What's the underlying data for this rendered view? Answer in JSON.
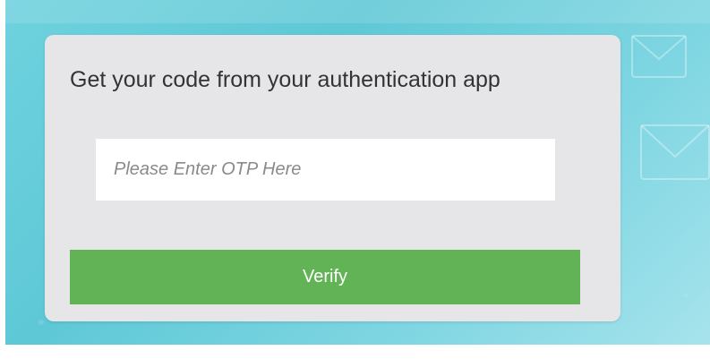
{
  "otp_card": {
    "title": "Get your code from your authentication app",
    "otp_input": {
      "value": "",
      "placeholder": "Please Enter OTP Here"
    },
    "verify_label": "Verify"
  },
  "colors": {
    "background_accent": "#5ec8d6",
    "card_background": "#e6e6e8",
    "verify_button": "#61b356",
    "input_background": "#ffffff"
  },
  "background_icons": [
    "envelope-icon",
    "envelope-icon"
  ]
}
